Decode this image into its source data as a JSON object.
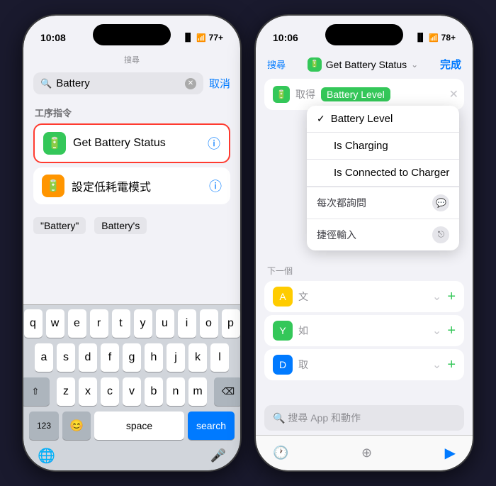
{
  "leftPhone": {
    "statusTime": "10:08",
    "batteryPct": "77+",
    "navHint": "搜尋",
    "searchPlaceholder": "Battery",
    "cancelLabel": "取消",
    "sectionHeader": "工序指令",
    "item1": {
      "name": "Get Battery Status",
      "iconEmoji": "🔋"
    },
    "item2": {
      "name": "設定低耗電模式",
      "iconEmoji": "🔋"
    },
    "suggestion1": "\"Battery\"",
    "suggestion2": "Battery's",
    "keyboard": {
      "row1": [
        "q",
        "w",
        "e",
        "r",
        "t",
        "y",
        "u",
        "i",
        "o",
        "p"
      ],
      "row2": [
        "a",
        "s",
        "d",
        "f",
        "g",
        "h",
        "j",
        "k",
        "l"
      ],
      "row3": [
        "z",
        "x",
        "c",
        "v",
        "b",
        "n",
        "m"
      ],
      "spaceLabel": "space",
      "searchLabel": "search"
    }
  },
  "rightPhone": {
    "statusTime": "10:06",
    "batteryPct": "78+",
    "navHint": "搜尋",
    "doneLabel": "完成",
    "actionLabel": "取得",
    "actionValue": "Battery Level",
    "dropdownItems": [
      {
        "label": "Battery Level",
        "checked": true
      },
      {
        "label": "Is Charging",
        "checked": false
      },
      {
        "label": "Is Connected to Charger",
        "checked": false
      }
    ],
    "dropdown2Label1": "每次都詢問",
    "dropdown2Label2": "捷徑輸入",
    "nextLabel": "下一個",
    "flow1Text": "文",
    "flow2Text": "如",
    "flow3Text": "取",
    "headerTitle": "Get Battery Status",
    "bottomSearchPlaceholder": "🔍 搜尋 App 和動作"
  }
}
